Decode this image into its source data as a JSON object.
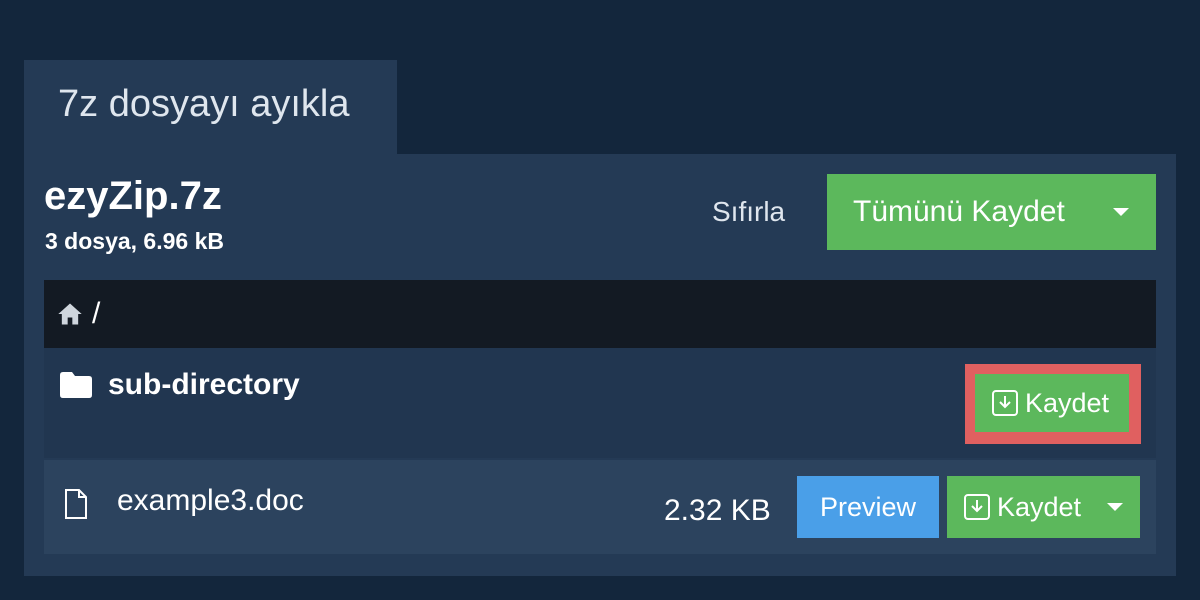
{
  "tab": {
    "title": "7z dosyayı ayıkla"
  },
  "archive": {
    "name": "ezyZip.7z",
    "info": "3 dosya, 6.96 kB"
  },
  "actions": {
    "reset_label": "Sıfırla",
    "save_all_label": "Tümünü Kaydet"
  },
  "breadcrumb": {
    "separator": "/"
  },
  "directory": {
    "name": "sub-directory",
    "save_label": "Kaydet"
  },
  "file": {
    "name": "example3.doc",
    "size": "2.32 KB",
    "preview_label": "Preview",
    "save_label": "Kaydet"
  },
  "icons": {
    "home": "home-icon",
    "folder": "folder-icon",
    "file": "file-icon",
    "download": "download-icon",
    "caret": "chevron-down-icon"
  },
  "colors": {
    "background": "#13263c",
    "panel": "#243a55",
    "green": "#5cb85c",
    "blue": "#4a9fe8",
    "highlight": "#e06060",
    "breadcrumb_bg": "#131a23"
  }
}
